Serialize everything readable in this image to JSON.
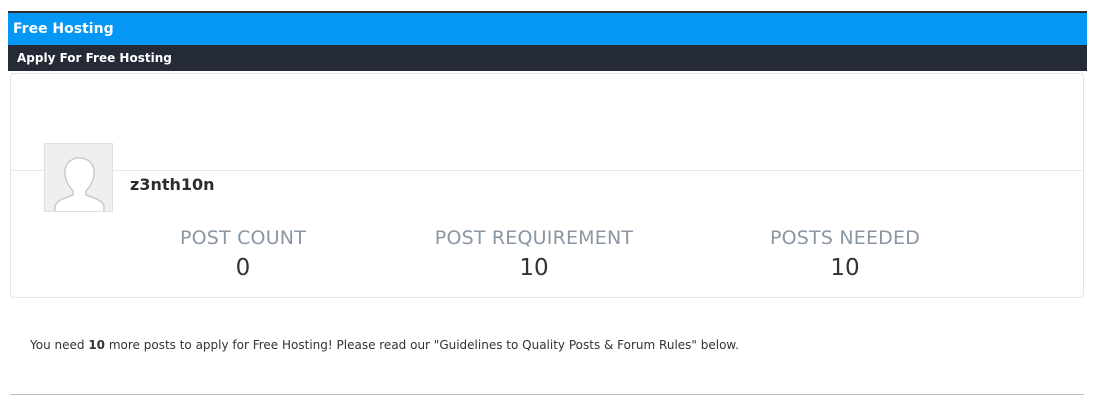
{
  "header": {
    "title": "Free Hosting",
    "subtitle": "Apply For Free Hosting"
  },
  "profile": {
    "username": "z3nth10n",
    "avatar_icon": "user-silhouette-icon"
  },
  "stats": [
    {
      "label": "POST COUNT",
      "value": "0"
    },
    {
      "label": "POST REQUIREMENT",
      "value": "10"
    },
    {
      "label": "POSTS NEEDED",
      "value": "10"
    }
  ],
  "message": {
    "prefix": "You need ",
    "count": "10",
    "suffix": " more posts to apply for Free Hosting! Please read our \"Guidelines to Quality Posts & Forum Rules\" below."
  },
  "colors": {
    "title_bar": "#0497f6",
    "sub_bar": "#242b36",
    "stat_label": "#8a96a3"
  }
}
